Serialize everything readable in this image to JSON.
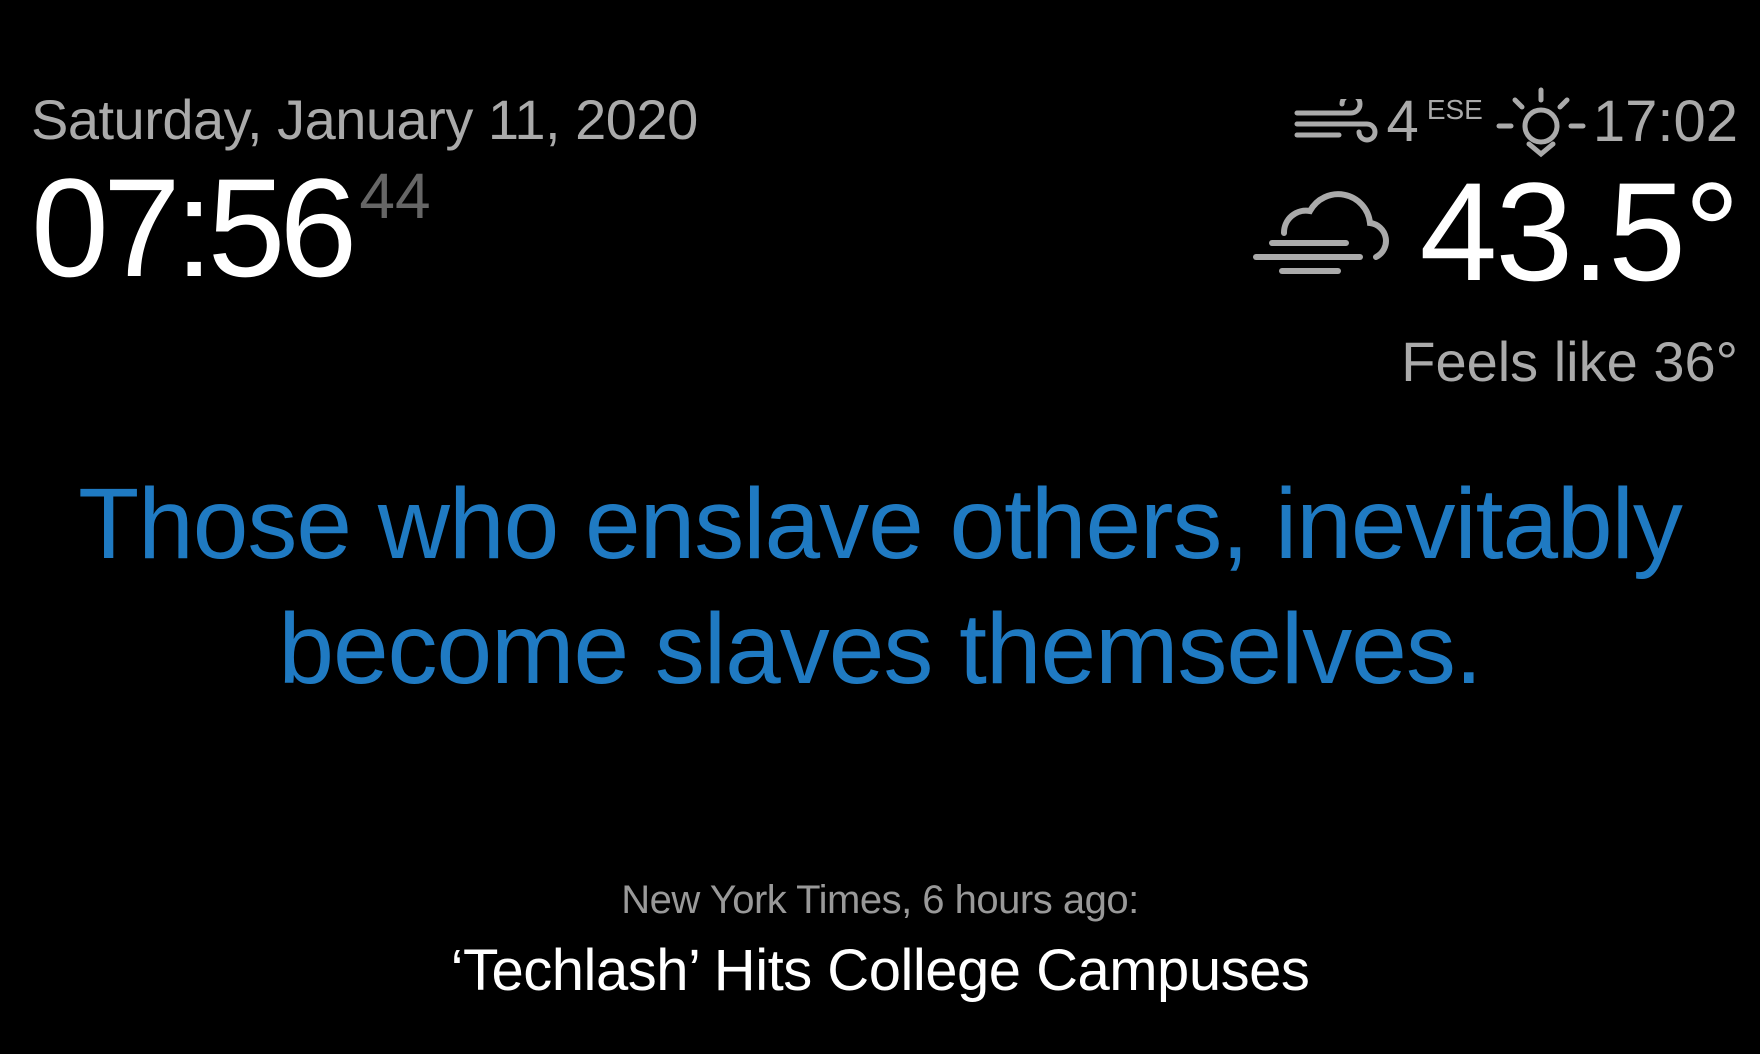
{
  "clock": {
    "date": "Saturday, January 11, 2020",
    "time_hm": "07:56",
    "time_seconds": "44"
  },
  "weather": {
    "wind_icon": "wind-icon",
    "wind_speed": "4",
    "wind_direction": "ESE",
    "sunset_icon": "sunset-icon",
    "sunset_time": "17:02",
    "condition_icon": "fog-cloud-icon",
    "temperature": "43.5°",
    "feels_like": "Feels like 36°"
  },
  "compliment": {
    "line1": "Those who enslave others, inevitably",
    "line2": "become slaves themselves."
  },
  "news": {
    "source": "New York Times, 6 hours ago:",
    "headline": "‘Techlash’ Hits College Campuses"
  },
  "colors": {
    "background": "#000000",
    "bright": "#ffffff",
    "normal": "#aaaaaa",
    "dimmed": "#666666",
    "quote_accent": "#1f7ac2"
  }
}
